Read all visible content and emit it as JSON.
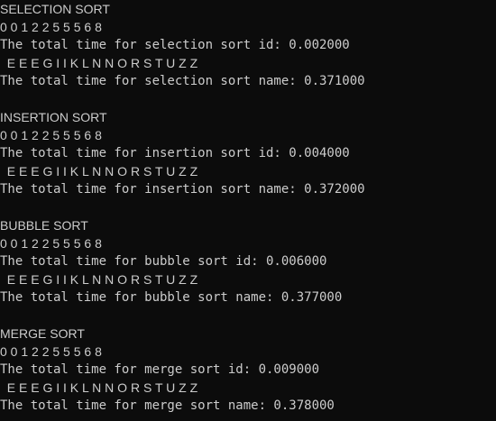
{
  "theme": {
    "background": "#0c0c0c",
    "foreground": "#cccccc"
  },
  "console": {
    "blocks": [
      {
        "heading": "SELECTION SORT",
        "ids": "0 0 1 2 2 5 5 5 6 8",
        "id_time": "The total time for selection sort id: 0.002000",
        "names": "  E E E G I I K L N N O R S T U Z Z",
        "name_time": "The total time for selection sort name: 0.371000"
      },
      {
        "heading": "INSERTION SORT",
        "ids": "0 0 1 2 2 5 5 5 6 8",
        "id_time": "The total time for insertion sort id: 0.004000",
        "names": "  E E E G I I K L N N O R S T U Z Z",
        "name_time": "The total time for insertion sort name: 0.372000"
      },
      {
        "heading": "BUBBLE SORT",
        "ids": "0 0 1 2 2 5 5 5 6 8",
        "id_time": "The total time for bubble sort id: 0.006000",
        "names": "  E E E G I I K L N N O R S T U Z Z",
        "name_time": "The total time for bubble sort name: 0.377000"
      },
      {
        "heading": "MERGE SORT",
        "ids": "0 0 1 2 2 5 5 5 6 8",
        "id_time": "The total time for merge sort id: 0.009000",
        "names": "  E E E G I I K L N N O R S T U Z Z",
        "name_time": "The total time for merge sort name: 0.378000"
      }
    ]
  }
}
